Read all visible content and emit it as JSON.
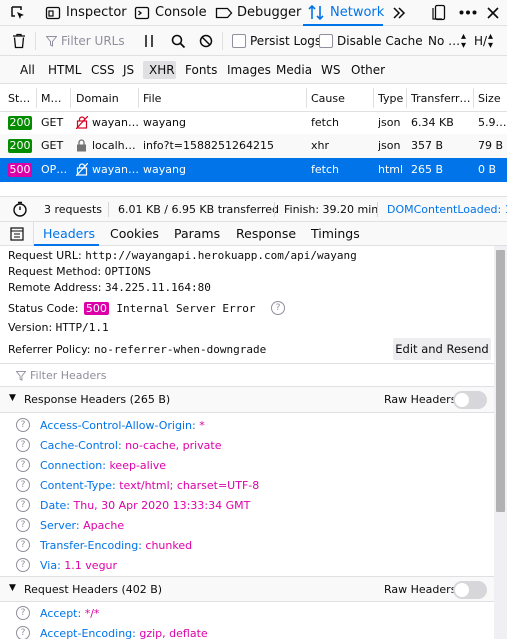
{
  "toolbar": {
    "tabs": [
      {
        "label": "Inspector"
      },
      {
        "label": "Console"
      },
      {
        "label": "Debugger"
      },
      {
        "label": "Network"
      }
    ]
  },
  "net_toolbar": {
    "filter_placeholder": "Filter URLs",
    "persist_logs": "Persist Logs",
    "disable_cache": "Disable Cache",
    "throttle": "No …",
    "har": "H/"
  },
  "type_filters": [
    "All",
    "HTML",
    "CSS",
    "JS",
    "XHR",
    "Fonts",
    "Images",
    "Media",
    "WS",
    "Other"
  ],
  "table": {
    "headers": [
      "St…",
      "M…",
      "Domain",
      "File",
      "Cause",
      "Type",
      "Transferr…",
      "Size"
    ],
    "rows": [
      {
        "status": "200",
        "method": "GET",
        "domain": "wayan…",
        "file": "wayang",
        "cause": "fetch",
        "type": "json",
        "transferred": "6.34 KB",
        "size": "5.9…"
      },
      {
        "status": "200",
        "method": "GET",
        "domain": "localh…",
        "file": "info?t=1588251264215",
        "cause": "xhr",
        "type": "json",
        "transferred": "357 B",
        "size": "79 B"
      },
      {
        "status": "500",
        "method": "OP…",
        "domain": "wayan…",
        "file": "wayang",
        "cause": "fetch",
        "type": "html",
        "transferred": "265 B",
        "size": "0 B"
      }
    ]
  },
  "summary": {
    "requests": "3 requests",
    "transferred": "6.01 KB / 6.95 KB transferred",
    "finish": "Finish: 39.20 min",
    "domcontent": "DOMContentLoaded: 1."
  },
  "detail_tabs": [
    "Headers",
    "Cookies",
    "Params",
    "Response",
    "Timings"
  ],
  "details": {
    "request_url_label": "Request URL:",
    "request_url": "http://wayangapi.herokuapp.com/api/wayang",
    "request_method_label": "Request Method:",
    "request_method": "OPTIONS",
    "remote_address_label": "Remote Address:",
    "remote_address": "34.225.11.164:80",
    "status_code_label": "Status Code:",
    "status_code": "500",
    "status_text": "Internal Server Error",
    "version_label": "Version:",
    "version": "HTTP/1.1",
    "referrer_label": "Referrer Policy:",
    "referrer": "no-referrer-when-downgrade",
    "edit_resend": "Edit and Resend",
    "filter_headers_placeholder": "Filter Headers",
    "response_headers_title": "Response Headers (265 B)",
    "raw_headers": "Raw Headers",
    "request_headers_title": "Request Headers (402 B)",
    "response_headers": [
      {
        "name": "Access-Control-Allow-Origin:",
        "value": "*"
      },
      {
        "name": "Cache-Control:",
        "value": "no-cache, private"
      },
      {
        "name": "Connection:",
        "value": "keep-alive"
      },
      {
        "name": "Content-Type:",
        "value": "text/html; charset=UTF-8"
      },
      {
        "name": "Date:",
        "value": "Thu, 30 Apr 2020 13:33:34 GMT"
      },
      {
        "name": "Server:",
        "value": "Apache"
      },
      {
        "name": "Transfer-Encoding:",
        "value": "chunked"
      },
      {
        "name": "Via:",
        "value": "1.1 vegur"
      }
    ],
    "request_headers": [
      {
        "name": "Accept:",
        "value": "*/*"
      },
      {
        "name": "Accept-Encoding:",
        "value": "gzip, deflate"
      }
    ]
  },
  "colors": {
    "accent": "#0074e8",
    "selected_row": "#0074e8",
    "status_200": "#058b00",
    "status_500": "#dd00a9"
  }
}
